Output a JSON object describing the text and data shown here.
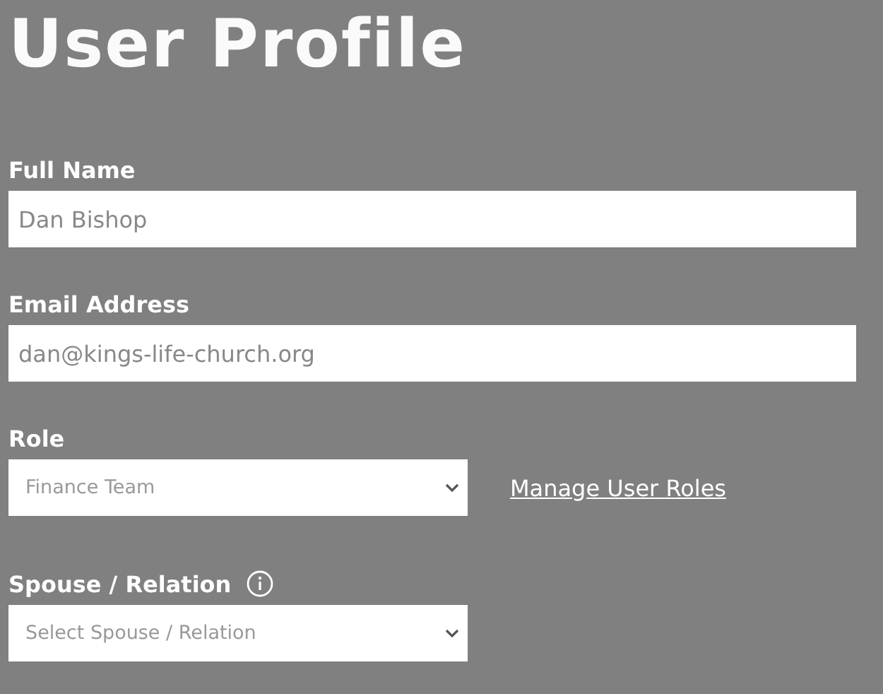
{
  "title": "User Profile",
  "fields": [
    {
      "kind": "text",
      "label": "Full Name",
      "value": "Dan Bishop"
    },
    {
      "kind": "text",
      "label": "Email Address",
      "value": "dan@kings-life-church.org"
    },
    {
      "kind": "select",
      "label": "Role",
      "value": "Finance Team",
      "link": "Manage User Roles"
    },
    {
      "kind": "select",
      "label": "Spouse / Relation",
      "info": true,
      "placeholder": "Select Spouse / Relation"
    }
  ]
}
